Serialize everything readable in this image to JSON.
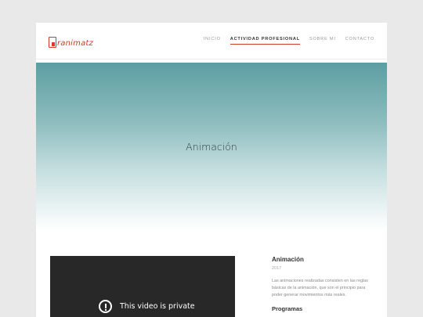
{
  "brand": {
    "logo_initial": "G",
    "logo_text": "ranimatz",
    "accent_color": "#d33a2c"
  },
  "nav": {
    "items": [
      {
        "label": "INICIO",
        "active": false
      },
      {
        "label": "ACTIVIDAD PROFESIONAL",
        "active": true
      },
      {
        "label": "SOBRE MI",
        "active": false
      },
      {
        "label": "CONTACTO",
        "active": false
      }
    ]
  },
  "hero": {
    "title": "Animación"
  },
  "video": {
    "message": "This video is private",
    "icon": "alert-circle-icon"
  },
  "sidebar": {
    "title": "Animación",
    "year": "2017",
    "description": "Las animaciones realizadas consisten en las reglas básicas de la animación, que son el principio para poder generar movimientos más reales.",
    "subheading": "Programas"
  }
}
